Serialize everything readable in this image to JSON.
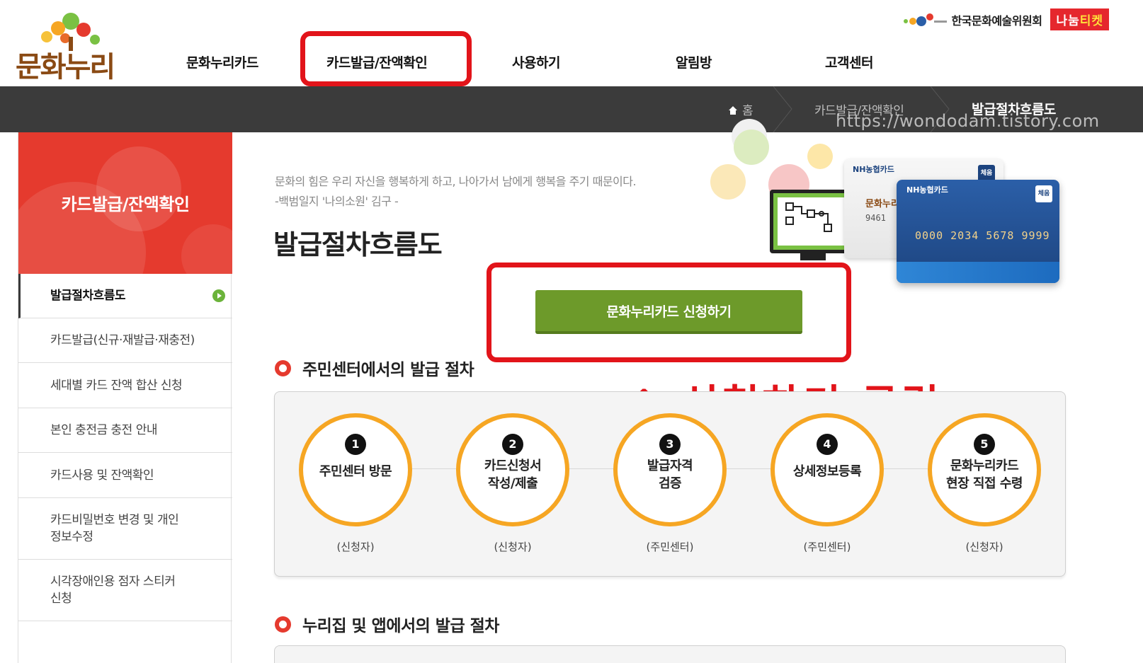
{
  "header": {
    "logo_text": "문화누리",
    "nav": [
      "문화누리카드",
      "카드발급/잔액확인",
      "사용하기",
      "알림방",
      "고객센터"
    ],
    "org_name": "한국문화예술위원회",
    "nanum_ticket": {
      "part1": "나눔",
      "part2": "티켓"
    }
  },
  "breadcrumb": {
    "home": "홈",
    "level1": "카드발급/잔액확인",
    "current": "발급절차흐름도",
    "watermark": "https://wondodam.tistory.com"
  },
  "sidebar": {
    "title": "카드발급/잔액확인",
    "items": [
      "발급절차흐름도",
      "카드발급(신규·재발급·재충전)",
      "세대별 카드 잔액 합산 신청",
      "본인 충전금 충전 안내",
      "카드사용 및 잔액확인",
      "카드비밀번호 변경 및 개인\n정보수정",
      "시각장애인용 점자 스티커\n신청"
    ]
  },
  "main": {
    "quote_line1": "문화의 힘은 우리 자신을 행복하게 하고, 나아가서 남에게 행복을 주기 때문이다.",
    "quote_line2": "-백범일지 '나의소원' 김구 -",
    "page_title": "발급절차흐름도",
    "apply_button": "문화누리카드 신청하기",
    "annotation": "↑ 신청하기 클릭",
    "section1_title": "주민센터에서의 발급 절차",
    "section2_title": "누리집 및 앱에서의 발급 절차",
    "steps": [
      {
        "num": "1",
        "label": "주민센터 방문",
        "sub": "(신청자)"
      },
      {
        "num": "2",
        "label": "카드신청서\n작성/제출",
        "sub": "(신청자)"
      },
      {
        "num": "3",
        "label": "발급자격\n검증",
        "sub": "(주민센터)"
      },
      {
        "num": "4",
        "label": "상세정보등록",
        "sub": "(주민센터)"
      },
      {
        "num": "5",
        "label": "문화누리카드\n현장 직접 수령",
        "sub": "(신청자)"
      }
    ],
    "card_front": {
      "brand": "NH농협카드",
      "badge": "체움",
      "number": "0000 2034 5678 9999"
    },
    "card_back": {
      "brand": "NH농협카드",
      "badge": "체움",
      "text": "문화누리",
      "digits": "9461"
    }
  },
  "colors": {
    "accent_red": "#e53a2e",
    "button_green": "#6d9a2a",
    "step_orange": "#f6a623",
    "highlight_red": "#e2141a"
  }
}
